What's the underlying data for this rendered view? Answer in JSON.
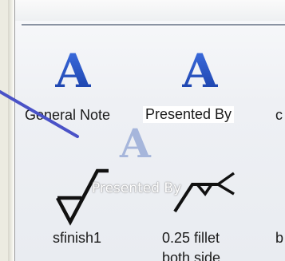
{
  "palette": {
    "items": [
      {
        "label": "General Note",
        "icon": "text-a-icon"
      },
      {
        "label": "Presented By",
        "icon": "text-a-icon"
      },
      {
        "label": "c",
        "icon": ""
      },
      {
        "label": "sfinish1",
        "icon": "surface-finish-icon"
      },
      {
        "label": "0.25 fillet",
        "label2": "both side",
        "icon": "fillet-weld-icon"
      },
      {
        "label": "b",
        "icon": ""
      }
    ],
    "drag_ghost": {
      "label": "Presented By",
      "icon": "text-a-icon"
    }
  },
  "colors": {
    "accent_blue": "#1f4fc4",
    "pointer": "#4a52c7",
    "background": "#ecebe1"
  }
}
